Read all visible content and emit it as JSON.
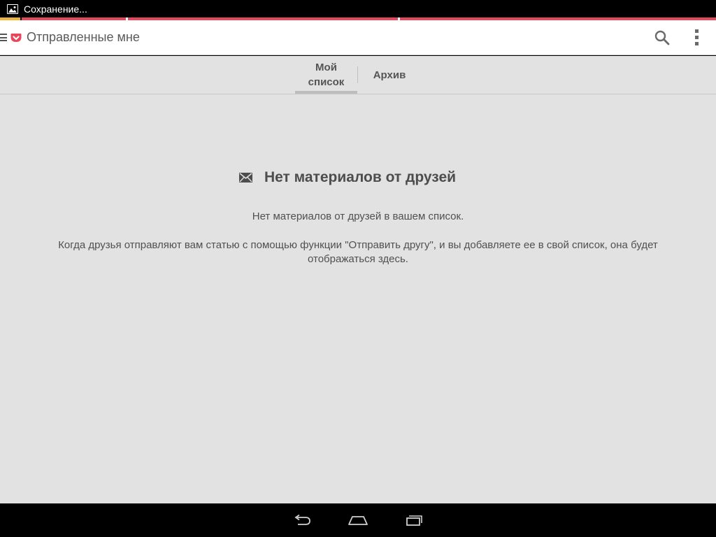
{
  "status_bar": {
    "notification_icon": "image-icon",
    "text": "Сохранение..."
  },
  "progress_strip": {
    "colors": [
      "#f0b43c",
      "#e8465b",
      "#e8465b",
      "#e8465b"
    ]
  },
  "app_bar": {
    "menu_icon": "hamburger-icon",
    "logo_icon": "pocket-logo-icon",
    "title": "Отправленные мне",
    "search_icon": "search-icon",
    "overflow_icon": "overflow-menu-icon"
  },
  "tabs": {
    "my_list": "Мой список",
    "archive": "Архив"
  },
  "empty_state": {
    "icon": "mail-icon",
    "title": "Нет материалов от друзей",
    "line1": "Нет материалов от друзей в вашем список.",
    "line2": "Когда друзья отправляют вам статью с помощью функции \"Отправить другу\", и вы добавляете ее в свой список, она будет отображаться здесь."
  },
  "nav_bar": {
    "back_icon": "back-icon",
    "home_icon": "home-icon",
    "recents_icon": "recents-icon"
  },
  "colors": {
    "accent": "#e8465b",
    "background": "#e2e2e2",
    "app_bar": "#ffffff"
  }
}
